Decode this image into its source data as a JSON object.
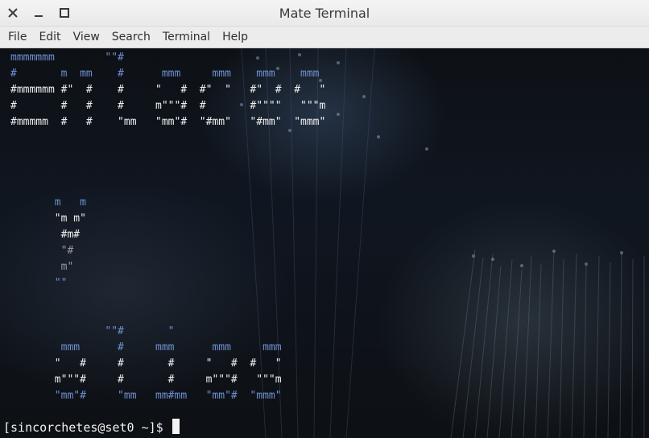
{
  "window": {
    "title": "Mate Terminal",
    "controls": [
      "close-icon",
      "minimize-icon",
      "maximize-icon"
    ]
  },
  "menubar": {
    "items": [
      {
        "label": "File"
      },
      {
        "label": "Edit"
      },
      {
        "label": "View"
      },
      {
        "label": "Search"
      },
      {
        "label": "Terminal"
      },
      {
        "label": "Help"
      }
    ]
  },
  "terminal": {
    "banner_lines": [
      "mmmmmmm        \"\"#",
      "#       m  mm    #      mmm     mmm    mmm    mmm",
      "#mmmmmm #\"  #    #     \"   #  #\"  \"   #\"  #  #   \"",
      "#       #   #    #     m\"\"\"#  #       #\"\"\"\"   \"\"\"m",
      "#mmmmm  #   #    \"mm   \"mm\"#  \"#mm\"   \"#mm\"  \"mmm\"",
      "",
      "",
      "",
      "",
      "       m   m",
      "       \"m m\"",
      "        #m#",
      "        \"#",
      "        m\"",
      "       \"\"",
      "",
      "",
      "               \"\"#       \"",
      "        mmm      #     mmm      mmm     mmm",
      "       \"   #     #       #     \"   #  #   \"",
      "       m\"\"\"#     #       #     m\"\"\"#   \"\"\"m",
      "       \"mm\"#     \"mm   mm#mm   \"mm\"#  \"mmm\""
    ],
    "prompt": "[sincorchetes@set0 ~]$ "
  },
  "colors": {
    "titlebar_bg": "#ececec",
    "terminal_fg": "#f0f0f0",
    "accent_blue": "#6f8fd0",
    "dim_grey": "#9a9a9a"
  }
}
